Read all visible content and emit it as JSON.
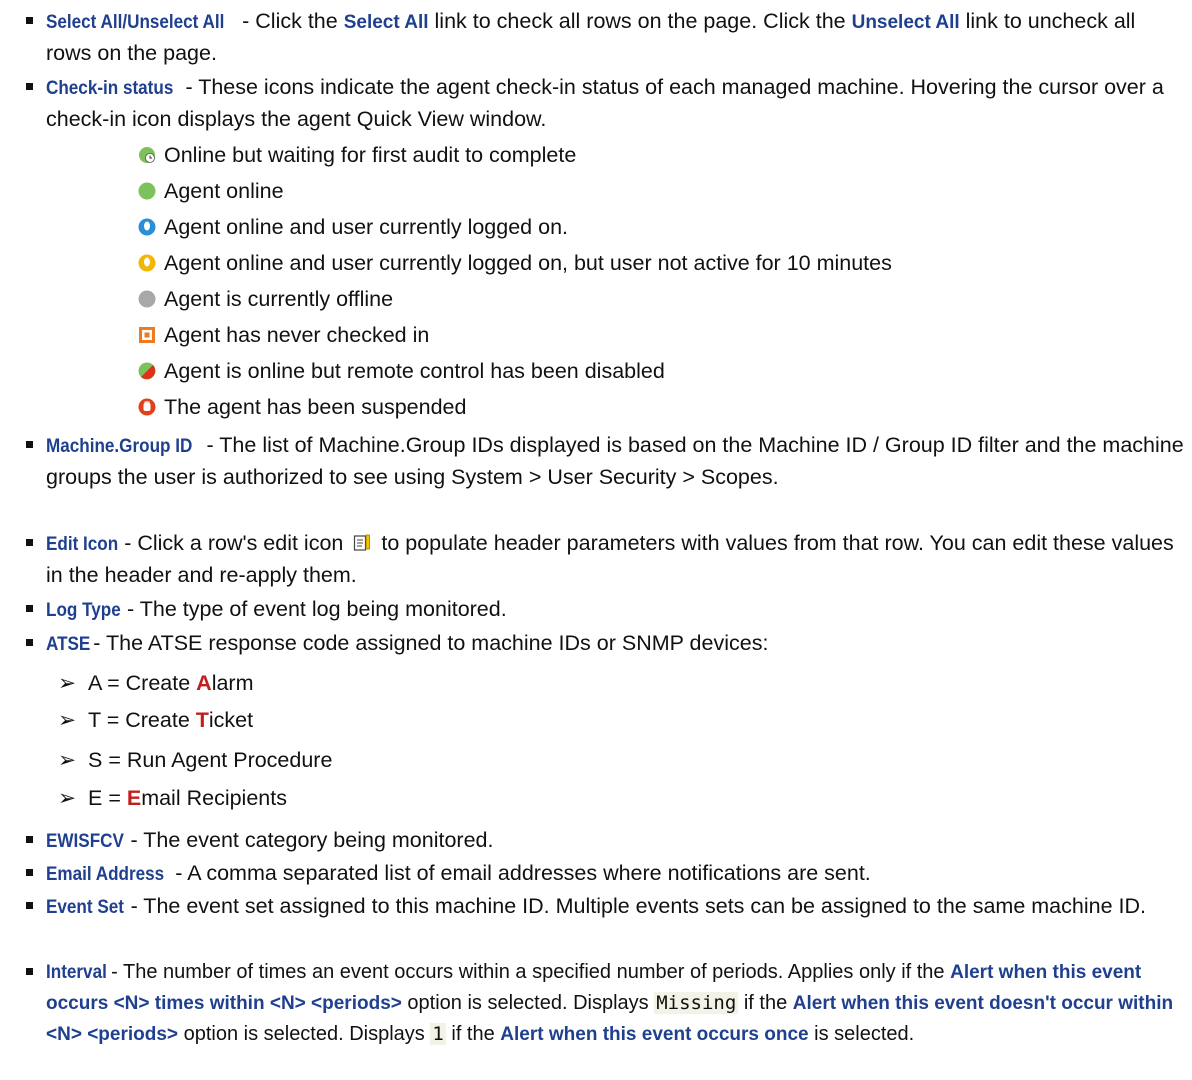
{
  "items": {
    "select_all": {
      "term": "Select All/Unselect All",
      "t1": " - Click the ",
      "l1": "Select All",
      "t2": " link to check all rows on the page. Click the ",
      "l2": "Unselect All",
      "t3": " link to uncheck all rows on the page."
    },
    "checkin": {
      "term": "Check-in status",
      "desc": " - These icons indicate the agent check-in status of each managed machine. Hovering the cursor over a check-in icon displays the agent Quick View window."
    },
    "machine_group": {
      "term": "Machine.Group ID",
      "desc": " - The list of Machine.Group IDs displayed is based on the Machine ID / Group ID filter and the machine groups the user is authorized to see using System > User Security > Scopes."
    },
    "edit_icon": {
      "term": "Edit Icon",
      "d1": " - Click a row's edit icon ",
      "d2": "to populate header parameters with values from that row. You can edit these values in the header and re-apply them."
    },
    "log_type": {
      "term": "Log Type",
      "desc": " - The type of event log being monitored."
    },
    "atse": {
      "term": "ATSE",
      "desc": " - The ATSE response code assigned to machine IDs or SNMP devices:"
    },
    "ewisfcv": {
      "term": "EWISFCV",
      "desc": " - The event category being monitored."
    },
    "email": {
      "term": "Email Address",
      "desc": " - A comma separated list of email addresses where notifications are sent."
    },
    "event_set": {
      "term": "Event Set",
      "desc": " - The event set assigned to this machine ID. Multiple events sets can be assigned to the same machine ID."
    },
    "interval": {
      "term": "Interval",
      "t1": " - The number of times an event occurs within a specified number of periods. Applies only if the ",
      "o1": "Alert when this event occurs <N> times within <N> <periods>",
      "t2": " option is selected. Displays ",
      "c1": "Missing",
      "t3": " if the ",
      "o2": "Alert when this event doesn't occur within <N> <periods>",
      "t4": " option is selected. Displays ",
      "c2": "1",
      "t5": " if the ",
      "o3": "Alert when this event occurs once",
      "t6": " is selected."
    }
  },
  "statuses": [
    {
      "icon": "green-clock-icon",
      "label": "Online but waiting for first audit to complete"
    },
    {
      "icon": "green-circle-icon",
      "label": "Agent online"
    },
    {
      "icon": "blue-user-icon",
      "label": "Agent online and user currently logged on."
    },
    {
      "icon": "yellow-user-icon",
      "label": "Agent online and user currently logged on, but user not active for 10 minutes"
    },
    {
      "icon": "gray-circle-icon",
      "label": "Agent is currently offline"
    },
    {
      "icon": "orange-square-icon",
      "label": "Agent has never checked in"
    },
    {
      "icon": "red-green-split-icon",
      "label": "Agent is online but remote control has been disabled"
    },
    {
      "icon": "red-hand-icon",
      "label": "The agent has been suspended"
    }
  ],
  "atse_codes": [
    {
      "pre": "A = Create ",
      "hl": "A",
      "post": "larm"
    },
    {
      "pre": "T = Create ",
      "hl": "T",
      "post": "icket"
    },
    {
      "pre": "S = Run Agent Procedure",
      "hl": "",
      "post": ""
    },
    {
      "pre": "E = ",
      "hl": "E",
      "post": "mail Recipients"
    }
  ],
  "colors": {
    "term": "#1f3f8f",
    "highlight": "#c0201c",
    "online": "#7cc15b",
    "offline": "#a8a8a8",
    "user_blue": "#2a8fd8",
    "user_yellow": "#f2b705",
    "never": "#f07b1f",
    "suspended": "#e0401a"
  }
}
